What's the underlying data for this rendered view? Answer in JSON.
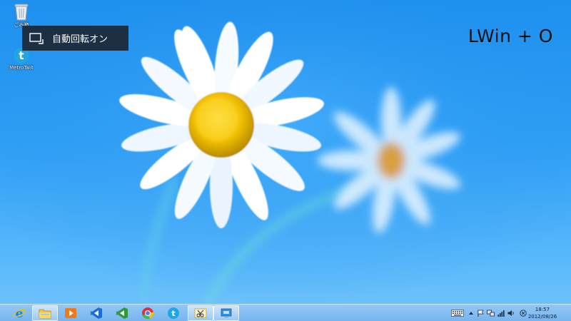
{
  "desktop": {
    "icons": [
      {
        "label": "ごみ箱",
        "icon": "recycle-bin-icon"
      },
      {
        "label": "MetroTwit",
        "icon": "metrotwit-icon"
      }
    ]
  },
  "toast": {
    "icon": "screen-rotation-icon",
    "text": "自動回転オン"
  },
  "hotkey_overlay": {
    "text": "LWin + O"
  },
  "taskbar": {
    "apps": [
      {
        "name": "Internet Explorer",
        "icon": "internet-explorer-icon",
        "active": false
      },
      {
        "name": "File Explorer",
        "icon": "file-explorer-icon",
        "active": true
      },
      {
        "name": "Media Player",
        "icon": "media-player-icon",
        "active": false
      },
      {
        "name": "Visual Studio",
        "icon": "visual-studio-icon",
        "active": false
      },
      {
        "name": "Visual Studio Express",
        "icon": "visual-studio-green-icon",
        "active": false
      },
      {
        "name": "Chrome",
        "icon": "chrome-icon",
        "active": false
      },
      {
        "name": "MetroTwit",
        "icon": "metrotwit-icon",
        "active": false
      },
      {
        "name": "Snipping Tool",
        "icon": "snipping-tool-icon",
        "active": true
      },
      {
        "name": "Remote Desktop",
        "icon": "remote-desktop-icon",
        "active": true
      }
    ],
    "tray": {
      "icons": [
        "keyboard-icon",
        "show-hidden-icons-icon",
        "action-center-flag-icon",
        "network-icon",
        "signal-icon",
        "volume-icon",
        "close-circle-icon"
      ],
      "time": "18:57",
      "date": "2012/08/26"
    }
  },
  "colors": {
    "sky": "#2fa0f5",
    "toast_bg": "#1c2634",
    "taskbar": "#86bdf0",
    "daisy_center": "#f2c200"
  }
}
